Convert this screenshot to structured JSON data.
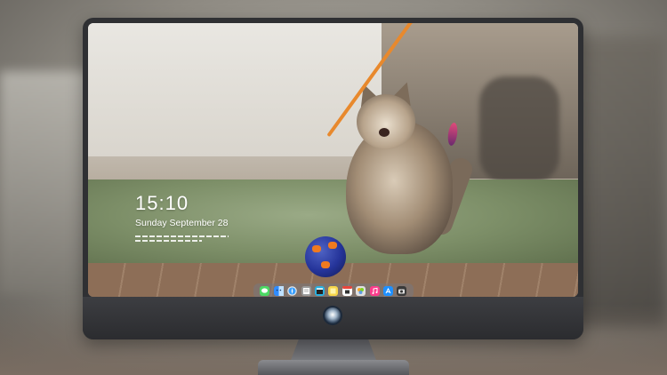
{
  "lock_screen": {
    "time": "15:10",
    "date": "Sunday September 28"
  },
  "dock": {
    "apps": [
      {
        "name": "messages-icon",
        "color": "#4cd964"
      },
      {
        "name": "finder-icon",
        "color": "#2f8cff"
      },
      {
        "name": "safari-icon",
        "color": "#e6e6e6"
      },
      {
        "name": "notes-icon",
        "color": "#9b9b9b"
      },
      {
        "name": "clapper-icon",
        "color": "#2ab0e0"
      },
      {
        "name": "stickies-icon",
        "color": "#f7d64a"
      },
      {
        "name": "calendar-icon",
        "color": "#ffffff"
      },
      {
        "name": "photos-icon",
        "color": "#e0e0e0"
      },
      {
        "name": "music-icon",
        "color": "#fc3c8c"
      },
      {
        "name": "app-store-icon",
        "color": "#1e90ff"
      },
      {
        "name": "camera-icon",
        "color": "#3a3a3a"
      }
    ]
  }
}
